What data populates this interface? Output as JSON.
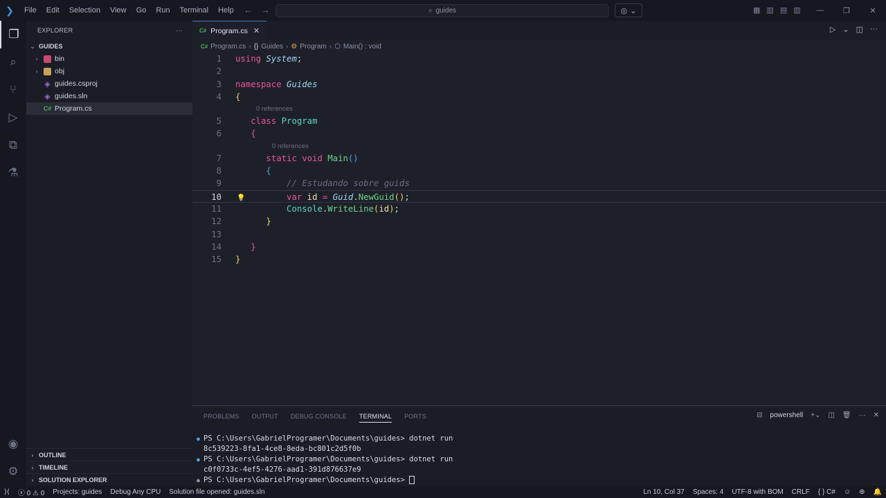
{
  "titlebar": {
    "menu": [
      "File",
      "Edit",
      "Selection",
      "View",
      "Go",
      "Run",
      "Terminal",
      "Help"
    ],
    "search_text": "guides"
  },
  "sidebar": {
    "header": "EXPLORER",
    "root": "GUIDES",
    "items": [
      {
        "label": "bin",
        "type": "folder"
      },
      {
        "label": "obj",
        "type": "folder"
      },
      {
        "label": "guides.csproj",
        "type": "file"
      },
      {
        "label": "guides.sln",
        "type": "file"
      },
      {
        "label": "Program.cs",
        "type": "file"
      }
    ],
    "bottom_sections": [
      "OUTLINE",
      "TIMELINE",
      "SOLUTION EXPLORER"
    ]
  },
  "editor": {
    "tab_label": "Program.cs",
    "tab_icon": "C#",
    "breadcrumb": [
      "Program.cs",
      "Guides",
      "Program",
      "Main() : void"
    ],
    "codelens": [
      "0 references",
      "0 references"
    ],
    "line_numbers": [
      "1",
      "2",
      "3",
      "4",
      "5",
      "6",
      "7",
      "8",
      "9",
      "10",
      "11",
      "12",
      "13",
      "14",
      "15"
    ]
  },
  "panel": {
    "tabs": [
      "PROBLEMS",
      "OUTPUT",
      "DEBUG CONSOLE",
      "TERMINAL",
      "PORTS"
    ],
    "shell": "powershell",
    "terminal": [
      {
        "prompt": "PS C:\\Users\\GabrielProgramer\\Documents\\guides> ",
        "cmd": "dotnet run"
      },
      {
        "output": "8c539223-8fa1-4ce8-8eda-bc801c2d5f0b"
      },
      {
        "prompt": "PS C:\\Users\\GabrielProgramer\\Documents\\guides> ",
        "cmd": "dotnet run"
      },
      {
        "output": "c0f0733c-4ef5-4276-aad1-391d876637e9"
      },
      {
        "prompt": "PS C:\\Users\\GabrielProgramer\\Documents\\guides> ",
        "cmd": ""
      }
    ]
  },
  "statusbar": {
    "errors": "0",
    "warnings": "0",
    "projects": "Projects: guides",
    "debug": "Debug Any CPU",
    "solution": "Solution file opened: guides.sln",
    "position": "Ln 10, Col 37",
    "spaces": "Spaces: 4",
    "encoding": "UTF-8 with BOM",
    "eol": "CRLF",
    "language": "C#"
  }
}
